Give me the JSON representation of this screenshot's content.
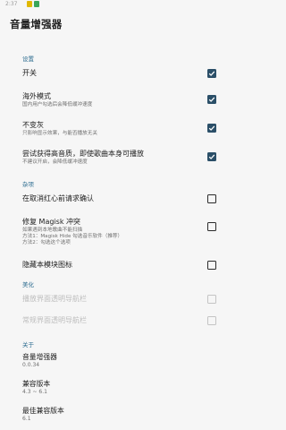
{
  "status_bar": {
    "time": "2:37"
  },
  "app": {
    "title": "音量增强器"
  },
  "sections": {
    "settings": "设置",
    "misc": "杂项",
    "beautify": "美化",
    "about": "关于"
  },
  "settings_items": [
    {
      "label": "开关",
      "summary": "",
      "checked": true
    },
    {
      "label": "海外模式",
      "summary": "国内用户勾选后会降低缓冲速度",
      "checked": true
    },
    {
      "label": "不变灰",
      "summary": "只影响显示效果，与能否播放无关",
      "checked": true
    },
    {
      "label": "尝试获得高音质，即使歌曲本身可播放",
      "summary": "不建议开启，会降低缓冲速度",
      "checked": true
    }
  ],
  "misc_items": [
    {
      "label": "在取消红心前请求确认",
      "summary_lines": [],
      "checked": false
    },
    {
      "label": "修复 Magisk 冲突",
      "summary_lines": [
        "如果遇到本地歌曲不能扫描",
        "方法1：Magisk Hide 勾选音乐软件（推荐）",
        "方法2：勾选这个选项"
      ],
      "checked": false
    },
    {
      "label": "隐藏本模块图标",
      "summary_lines": [],
      "checked": false
    }
  ],
  "beautify_items": [
    {
      "label": "播放界面透明导航栏",
      "checked": false,
      "disabled": true
    },
    {
      "label": "常规界面透明导航栏",
      "checked": false,
      "disabled": true
    }
  ],
  "about_items": [
    {
      "label": "音量增强器",
      "value": "0.0.34"
    },
    {
      "label": "兼容版本",
      "value": "4.3 ~ 6.1"
    },
    {
      "label": "最佳兼容版本",
      "value": "6.1"
    }
  ],
  "colors": {
    "accent": "#2b6b8f",
    "checkbox_checked": "#2b4f68",
    "background": "#f6f6f6"
  }
}
